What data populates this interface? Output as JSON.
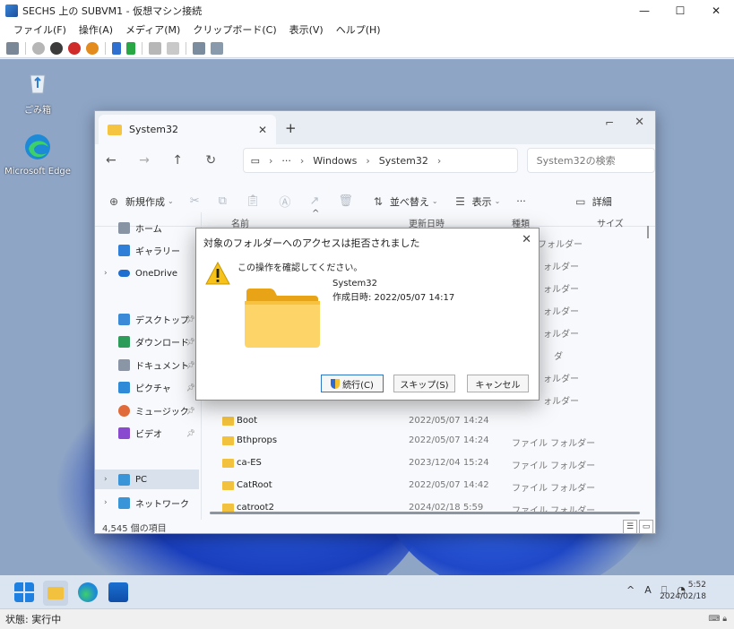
{
  "vm_window": {
    "title": "SECHS 上の SUBVM1 - 仮想マシン接続",
    "minimize": "—",
    "maximize": "☐",
    "close": "✕",
    "menu": [
      "ファイル(F)",
      "操作(A)",
      "メディア(M)",
      "クリップボード(C)",
      "表示(V)",
      "ヘルプ(H)"
    ],
    "status_label": "状態: 実行中"
  },
  "desktop": {
    "recycle_bin": "ごみ箱",
    "edge": "Microsoft Edge"
  },
  "explorer": {
    "tab_title": "System32",
    "tab_close": "✕",
    "new_tab": "+",
    "breadcrumbs": [
      "Windows",
      "System32"
    ],
    "search_placeholder": "System32の検索",
    "commands": {
      "new": "新規作成",
      "sort": "並べ替え",
      "view": "表示",
      "more": "···",
      "details": "詳細"
    },
    "sidebar": {
      "home": "ホーム",
      "gallery": "ギャラリー",
      "onedrive": "OneDrive",
      "desktop": "デスクトップ",
      "downloads": "ダウンロード",
      "documents": "ドキュメント",
      "pictures": "ピクチャ",
      "music": "ミュージック",
      "videos": "ビデオ",
      "pc": "PC",
      "network": "ネットワーク"
    },
    "columns": {
      "name": "名前",
      "date": "更新日時",
      "type": "種類",
      "size": "サイズ"
    },
    "partial_types": [
      "フォルダー",
      "ォルダー",
      "ォルダー",
      "ォルダー",
      "ォルダー",
      "ダ",
      "ォルダー",
      "ォルダー"
    ],
    "partial_row": {
      "name": "Boot",
      "date": "2022/05/07 14:24"
    },
    "files": [
      {
        "name": "Bthprops",
        "date": "2022/05/07 14:24",
        "type": "ファイル フォルダー"
      },
      {
        "name": "ca-ES",
        "date": "2023/12/04 15:24",
        "type": "ファイル フォルダー"
      },
      {
        "name": "CatRoot",
        "date": "2022/05/07 14:42",
        "type": "ファイル フォルダー"
      },
      {
        "name": "catroot2",
        "date": "2024/02/18 5:59",
        "type": "ファイル フォルダー"
      }
    ],
    "status_count": "4,545 個の項目"
  },
  "dialog": {
    "title": "対象のフォルダーへのアクセスは拒否されました",
    "close": "✕",
    "message": "この操作を確認してください。",
    "item_name": "System32",
    "item_date": "作成日時: 2022/05/07 14:17",
    "buttons": {
      "continue": "続行(C)",
      "skip": "スキップ(S)",
      "cancel": "キャンセル"
    }
  },
  "taskbar": {
    "tray_ime": "A",
    "clock_time": "5:52",
    "clock_date": "2024/02/18"
  }
}
